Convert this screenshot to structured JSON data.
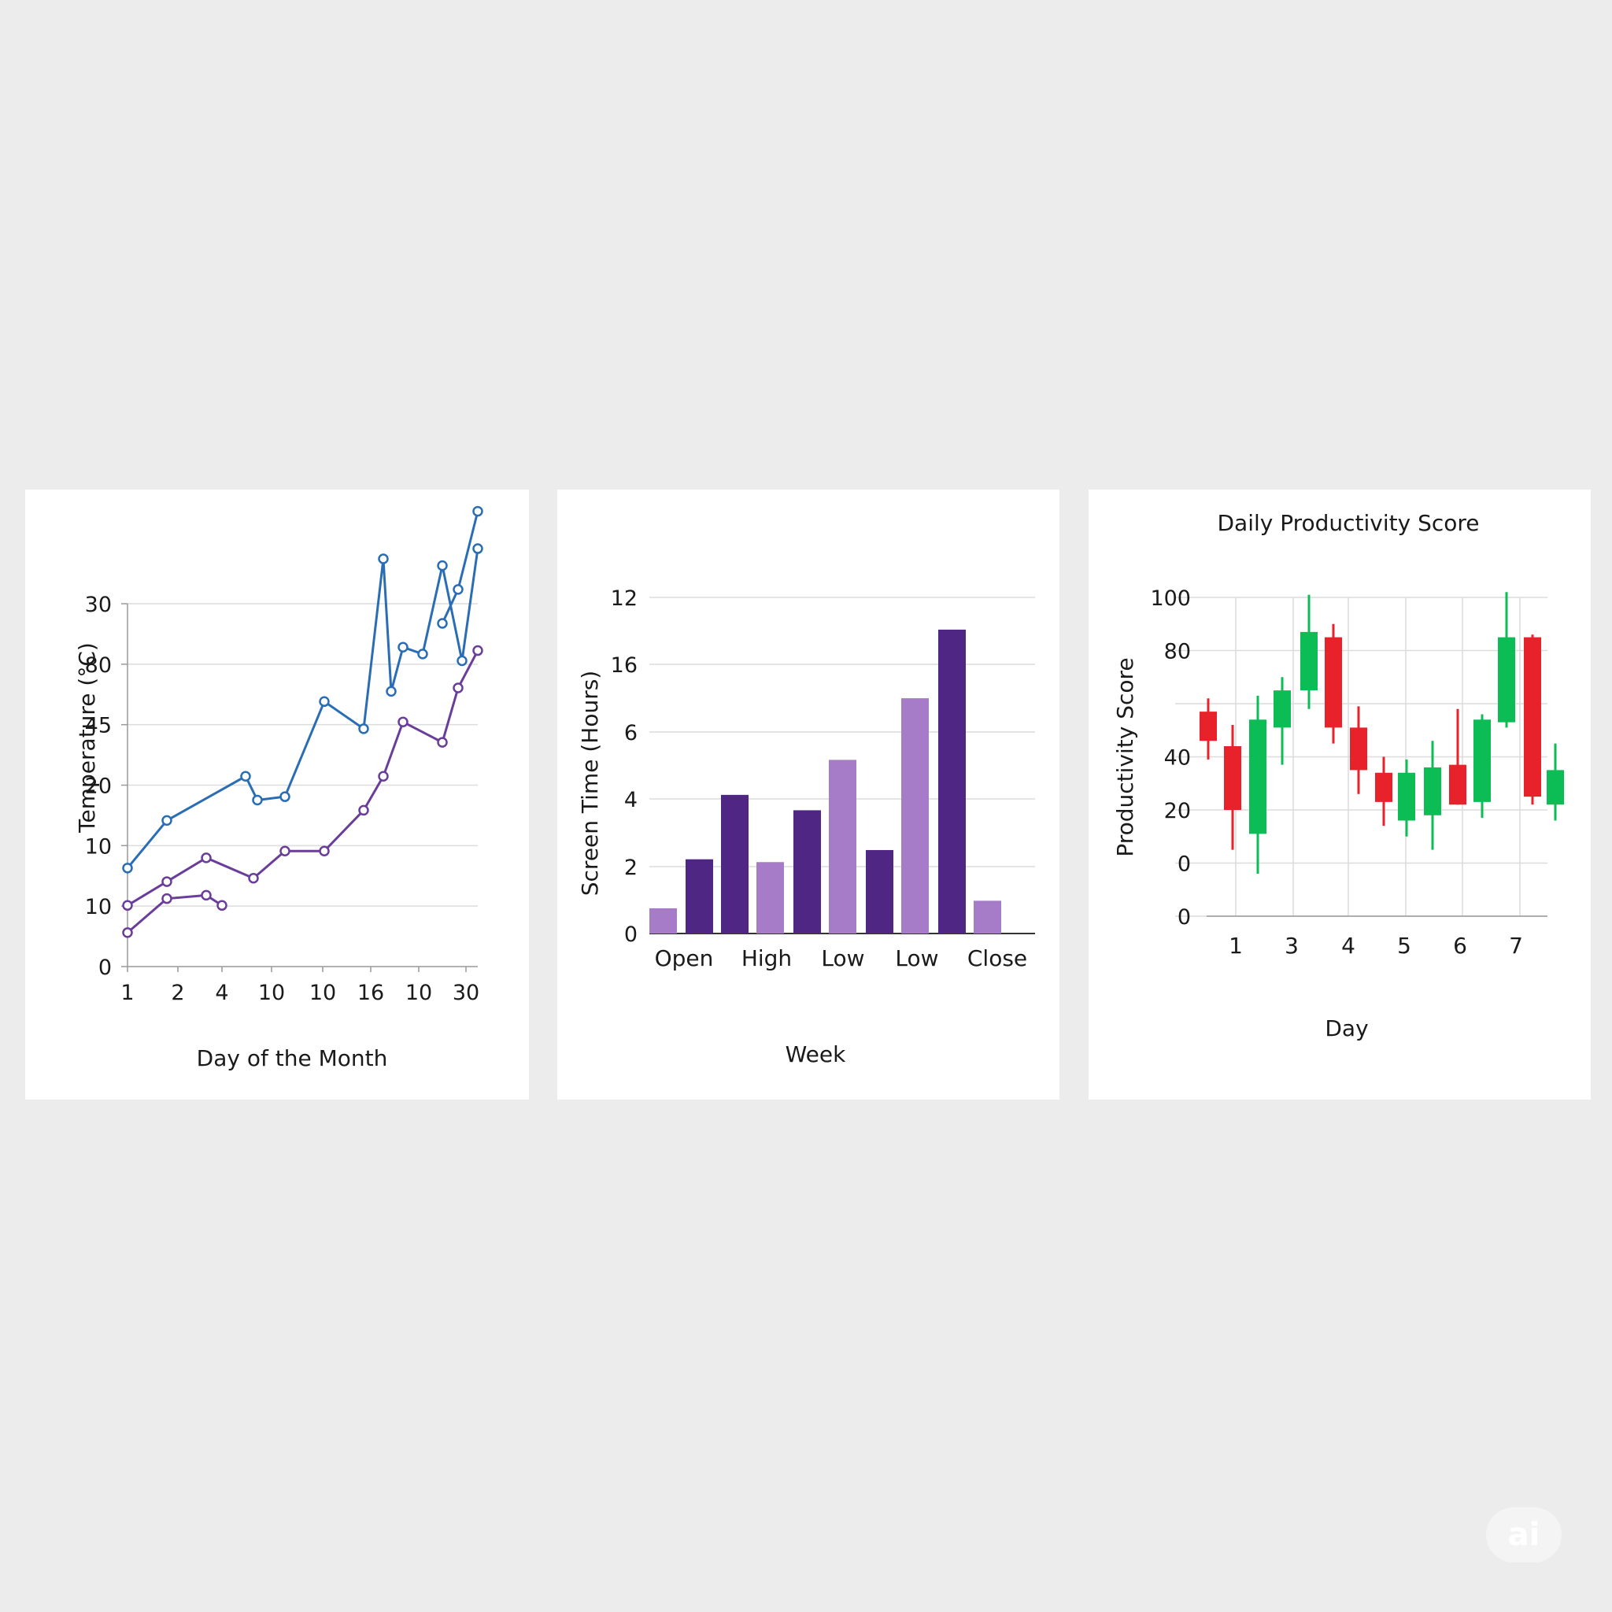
{
  "watermark": "ai",
  "chart_data": [
    {
      "type": "line",
      "title": "",
      "xlabel": "Day of the Month",
      "ylabel": "Temperature (°C)",
      "x_tick_labels": [
        "1",
        "2",
        "4",
        "10",
        "10",
        "16",
        "10",
        "30"
      ],
      "y_tick_labels": [
        "0",
        "10",
        "10",
        "20",
        "45",
        "80",
        "30"
      ],
      "ylim": [
        0,
        60
      ],
      "grid": "horizontal",
      "colors": {
        "upper": "#2a6db5",
        "lower": "#6a3d9a"
      },
      "series": [
        {
          "x": [
            1,
            2,
            4,
            4.3,
            5,
            6,
            7,
            7.5,
            7.7,
            8,
            8.5,
            9,
            9.5,
            9.9
          ],
          "values": [
            14.5,
            21.5,
            28,
            24.5,
            25,
            39,
            35,
            60,
            40.5,
            47,
            46,
            59,
            45,
            61.5
          ]
        },
        {
          "x": [
            9,
            9.4,
            9.9
          ],
          "values": [
            50.5,
            55.5,
            67
          ]
        },
        {
          "x": [
            1,
            2,
            3,
            4.2,
            5,
            6,
            7,
            7.5,
            8,
            9,
            9.4,
            9.9
          ],
          "values": [
            9,
            12.5,
            16,
            13,
            17,
            17,
            23,
            28,
            36,
            33,
            41,
            46.5
          ]
        },
        {
          "x": [
            1,
            2,
            3,
            3.4
          ],
          "values": [
            5,
            10,
            10.5,
            9
          ]
        }
      ]
    },
    {
      "type": "bar",
      "title": "",
      "xlabel": "Week",
      "ylabel": "Screen Time (Hours)",
      "categories": [
        "Open",
        "High",
        "Low",
        "Low",
        "Close"
      ],
      "y_tick_labels": [
        "0",
        "2",
        "4",
        "6",
        "16",
        "12"
      ],
      "ylim": [
        0,
        12
      ],
      "grid": "horizontal",
      "colors": {
        "dark": "#4f2683",
        "light": "#a67bc7"
      },
      "values": [
        0.9,
        2.65,
        4.95,
        2.55,
        4.4,
        6.2,
        2.98,
        8.4,
        10.85,
        1.17
      ]
    },
    {
      "type": "candlestick",
      "title": "Daily Productivity Score",
      "xlabel": "Day",
      "ylabel": "Productivity Score",
      "x_tick_labels": [
        "1",
        "3",
        "4",
        "5",
        "6",
        "7"
      ],
      "y_tick_labels": [
        "0",
        "0",
        "20",
        "40",
        "80",
        "100"
      ],
      "ylim": [
        -20,
        100
      ],
      "grid": "both",
      "colors": {
        "up": "#0cbc55",
        "down": "#e8222a"
      },
      "candles": [
        {
          "open": 57,
          "close": 46,
          "high": 62,
          "low": 39,
          "dir": "down"
        },
        {
          "open": 44,
          "close": 20,
          "high": 52,
          "low": 5,
          "dir": "down"
        },
        {
          "open": 11,
          "close": 54,
          "high": 63,
          "low": -4,
          "dir": "up"
        },
        {
          "open": 51,
          "close": 65,
          "high": 70,
          "low": 37,
          "dir": "up"
        },
        {
          "open": 65,
          "close": 87,
          "high": 101,
          "low": 58,
          "dir": "up"
        },
        {
          "open": 85,
          "close": 51,
          "high": 90,
          "low": 45,
          "dir": "down"
        },
        {
          "open": 51,
          "close": 35,
          "high": 59,
          "low": 26,
          "dir": "down"
        },
        {
          "open": 34,
          "close": 23,
          "high": 40,
          "low": 14,
          "dir": "down"
        },
        {
          "open": 16,
          "close": 34,
          "high": 39,
          "low": 10,
          "dir": "up"
        },
        {
          "open": 18,
          "close": 36,
          "high": 46,
          "low": 5,
          "dir": "up"
        },
        {
          "open": 37,
          "close": 22,
          "high": 58,
          "low": 22,
          "dir": "down"
        },
        {
          "open": 23,
          "close": 54,
          "high": 56,
          "low": 17,
          "dir": "up"
        },
        {
          "open": 53,
          "close": 85,
          "high": 102,
          "low": 51,
          "dir": "up"
        },
        {
          "open": 85,
          "close": 25,
          "high": 86,
          "low": 22,
          "dir": "down"
        },
        {
          "open": 22,
          "close": 35,
          "high": 45,
          "low": 16,
          "dir": "up"
        }
      ]
    }
  ]
}
